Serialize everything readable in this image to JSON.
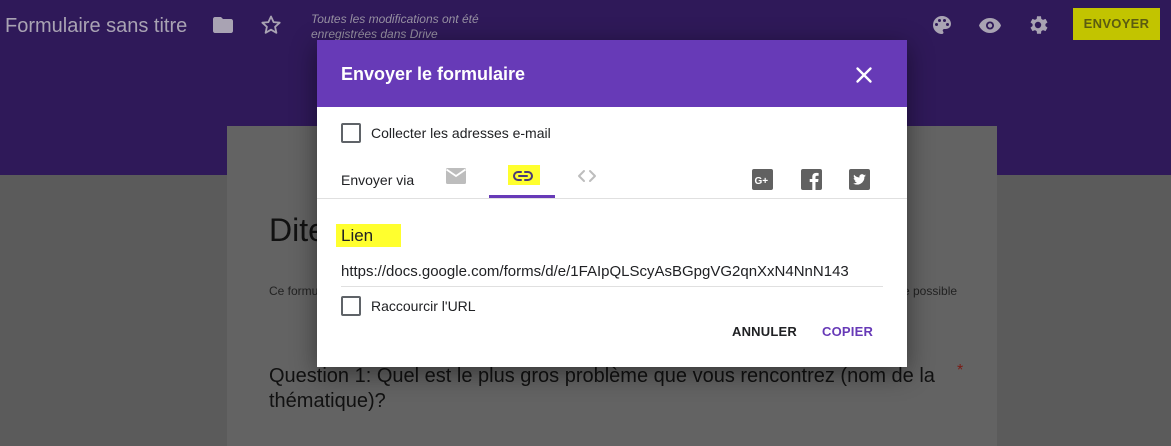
{
  "app": {
    "title": "Formulaire sans titre",
    "save_status": "Toutes les modifications ont été enregistrées dans Drive",
    "send_button": "ENVOYER",
    "icons": [
      "folder-icon",
      "star-icon",
      "palette-icon",
      "eye-icon",
      "gear-icon"
    ]
  },
  "form": {
    "title_partial": "Dite",
    "description_partial": "Ce formu",
    "description_end": "e possible",
    "question": "Question 1: Quel est le plus gros problème que vous rencontrez (nom de la thématique)?",
    "required_marker": "*"
  },
  "dialog": {
    "title": "Envoyer le formulaire",
    "collect_emails_label": "Collecter les adresses e-mail",
    "send_via_label": "Envoyer via",
    "tabs": [
      "email-icon",
      "link-icon",
      "embed-icon"
    ],
    "active_tab": "link-icon",
    "social": [
      "google-plus-icon",
      "facebook-icon",
      "twitter-icon"
    ],
    "link_heading": "Lien",
    "url": "https://docs.google.com/forms/d/e/1FAIpQLScyAsBGpgVG2qnXxN4NnN143",
    "shorten_url_label": "Raccourcir l'URL",
    "cancel_button": "ANNULER",
    "copy_button": "COPIER"
  },
  "colors": {
    "accent": "#673ab7",
    "highlight": "#ffff2e",
    "overlay_header": "#2f1959"
  }
}
